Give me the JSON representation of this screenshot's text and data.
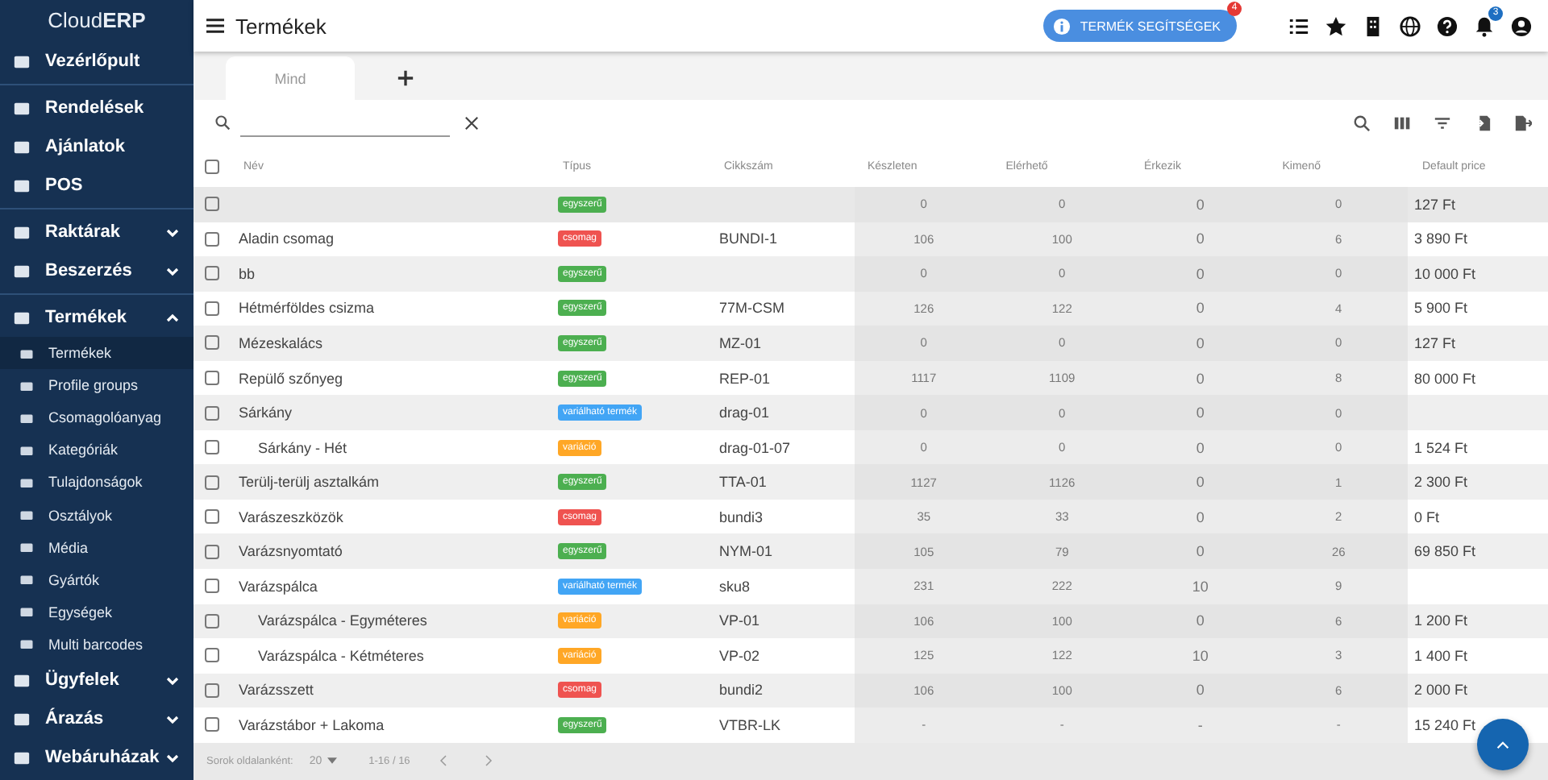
{
  "sidebar": {
    "logo": {
      "light": "Cloud",
      "bold": "ERP"
    },
    "groups": [
      {
        "items": [
          {
            "label": "Vezérlőpult",
            "selected": false
          }
        ]
      },
      {
        "items": [
          {
            "label": "Rendelések",
            "selected": false
          },
          {
            "label": "Ajánlatok",
            "selected": false
          },
          {
            "label": "POS",
            "selected": false
          }
        ]
      },
      {
        "items": [
          {
            "label": "Raktárak",
            "selected": false,
            "expanded": false
          },
          {
            "label": "Beszerzés",
            "selected": false,
            "expanded": false
          }
        ]
      },
      {
        "items": [
          {
            "label": "Termékek",
            "selected": false,
            "expanded": true,
            "children": [
              {
                "label": "Termékek",
                "selected": true
              },
              {
                "label": "Profile groups",
                "selected": false
              },
              {
                "label": "Csomagolóanyag",
                "selected": false
              },
              {
                "label": "Kategóriák",
                "selected": false
              },
              {
                "label": "Tulajdonságok",
                "selected": false
              },
              {
                "label": "Osztályok",
                "selected": false
              },
              {
                "label": "Média",
                "selected": false
              },
              {
                "label": "Gyártók",
                "selected": false
              },
              {
                "label": "Egységek",
                "selected": false
              },
              {
                "label": "Multi barcodes",
                "selected": false
              }
            ]
          },
          {
            "label": "Ügyfelek",
            "selected": false,
            "expanded": false
          },
          {
            "label": "Árazás",
            "selected": false,
            "expanded": false
          },
          {
            "label": "Webáruházak",
            "selected": false,
            "expanded": false
          }
        ]
      }
    ]
  },
  "header": {
    "title": "Termékek",
    "help_button": {
      "label": "TERMÉK SEGÍTSÉGEK",
      "badge": "4"
    },
    "notification_badge": "3"
  },
  "tabs": [
    {
      "label": "Mind",
      "selected": true
    }
  ],
  "table": {
    "all_checked": false,
    "columns": [
      "Név",
      "Típus",
      "Cikkszám",
      "Készleten",
      "Elérhető",
      "Érkezik",
      "Kimenő",
      "Default price"
    ],
    "rows": [
      {
        "name": "",
        "type": {
          "label": "egyszerű",
          "color": "#4caf50"
        },
        "sku": "",
        "stock": "0",
        "available": "0",
        "incoming": "0",
        "outgoing": "0",
        "price": "127 Ft",
        "checked": false
      },
      {
        "name": "Aladin csomag",
        "type": {
          "label": "csomag",
          "color": "#ef5350"
        },
        "sku": "BUNDI-1",
        "stock": "106",
        "available": "100",
        "incoming": "0",
        "outgoing": "6",
        "price": "3 890 Ft",
        "checked": false
      },
      {
        "name": "bb",
        "type": {
          "label": "egyszerű",
          "color": "#4caf50"
        },
        "sku": "",
        "stock": "0",
        "available": "0",
        "incoming": "0",
        "outgoing": "0",
        "price": "10 000 Ft",
        "checked": false
      },
      {
        "name": "Hétmérföldes csizma",
        "type": {
          "label": "egyszerű",
          "color": "#4caf50"
        },
        "sku": "77M-CSM",
        "stock": "126",
        "available": "122",
        "incoming": "0",
        "outgoing": "4",
        "price": "5 900 Ft",
        "checked": false
      },
      {
        "name": "Mézeskalács",
        "type": {
          "label": "egyszerű",
          "color": "#4caf50"
        },
        "sku": "MZ-01",
        "stock": "0",
        "available": "0",
        "incoming": "0",
        "outgoing": "0",
        "price": "127 Ft",
        "checked": false
      },
      {
        "name": "Repülő szőnyeg",
        "type": {
          "label": "egyszerű",
          "color": "#4caf50"
        },
        "sku": "REP-01",
        "stock": "1117",
        "available": "1109",
        "incoming": "0",
        "outgoing": "8",
        "price": "80 000 Ft",
        "checked": false
      },
      {
        "name": "Sárkány",
        "type": {
          "label": "variálható termék",
          "color": "#42a5f5"
        },
        "sku": "drag-01",
        "stock": "0",
        "available": "0",
        "incoming": "0",
        "outgoing": "0",
        "price": "",
        "checked": false,
        "children": [
          {
            "name": "Sárkány - Hét",
            "type": {
              "label": "variáció",
              "color": "#ffa726"
            },
            "sku": "drag-01-07",
            "stock": "0",
            "available": "0",
            "incoming": "0",
            "outgoing": "0",
            "price": "1 524 Ft",
            "checked": false
          }
        ]
      },
      {
        "name": "Terülj-terülj asztalkám",
        "type": {
          "label": "egyszerű",
          "color": "#4caf50"
        },
        "sku": "TTA-01",
        "stock": "1127",
        "available": "1126",
        "incoming": "0",
        "outgoing": "1",
        "price": "2 300 Ft",
        "checked": false
      },
      {
        "name": "Varászeszközök",
        "type": {
          "label": "csomag",
          "color": "#ef5350"
        },
        "sku": "bundi3",
        "stock": "35",
        "available": "33",
        "incoming": "0",
        "outgoing": "2",
        "price": "0 Ft",
        "checked": false
      },
      {
        "name": "Varázsnyomtató",
        "type": {
          "label": "egyszerű",
          "color": "#4caf50"
        },
        "sku": "NYM-01",
        "stock": "105",
        "available": "79",
        "incoming": "0",
        "outgoing": "26",
        "price": "69 850 Ft",
        "checked": false
      },
      {
        "name": "Varázspálca",
        "type": {
          "label": "variálható termék",
          "color": "#42a5f5"
        },
        "sku": "sku8",
        "stock": "231",
        "available": "222",
        "incoming": "10",
        "outgoing": "9",
        "price": "",
        "checked": false,
        "children": [
          {
            "name": "Varázspálca - Egyméteres",
            "type": {
              "label": "variáció",
              "color": "#ffa726"
            },
            "sku": "VP-01",
            "stock": "106",
            "available": "100",
            "incoming": "0",
            "outgoing": "6",
            "price": "1 200 Ft",
            "checked": false
          },
          {
            "name": "Varázspálca - Kétméteres",
            "type": {
              "label": "variáció",
              "color": "#ffa726"
            },
            "sku": "VP-02",
            "stock": "125",
            "available": "122",
            "incoming": "10",
            "outgoing": "3",
            "price": "1 400 Ft",
            "checked": false
          }
        ]
      },
      {
        "name": "Varázsszett",
        "type": {
          "label": "csomag",
          "color": "#ef5350"
        },
        "sku": "bundi2",
        "stock": "106",
        "available": "100",
        "incoming": "0",
        "outgoing": "6",
        "price": "2 000 Ft",
        "checked": false
      },
      {
        "name": "Varázstábor + Lakoma",
        "type": {
          "label": "egyszerű",
          "color": "#4caf50"
        },
        "sku": "VTBR-LK",
        "stock": "-",
        "available": "-",
        "incoming": "-",
        "outgoing": "-",
        "price": "15 240 Ft",
        "checked": false
      }
    ]
  },
  "footer": {
    "rows_label": "Sorok oldalanként:",
    "rows_value": "20",
    "range": "1-16 / 16"
  }
}
